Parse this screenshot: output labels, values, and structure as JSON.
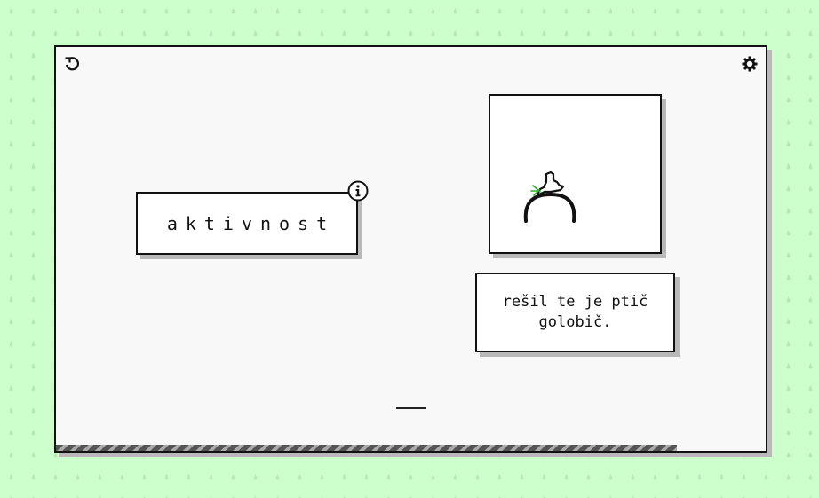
{
  "game": {
    "word": "aktivnost",
    "sentence": "rešil te je ptič golobič.",
    "answer_blank": "",
    "progress_fraction": 0.875
  },
  "icons": {
    "restart": "restart-icon",
    "settings": "gear-icon",
    "info": "info-icon",
    "illustration": "bird-on-arch-icon"
  },
  "colors": {
    "background": "#ccffcc",
    "pattern": "#b7e8b7",
    "card": "#f8f8f8",
    "border": "#111111",
    "shadow": "#b9b9b9",
    "accent": "#2faa2f"
  }
}
